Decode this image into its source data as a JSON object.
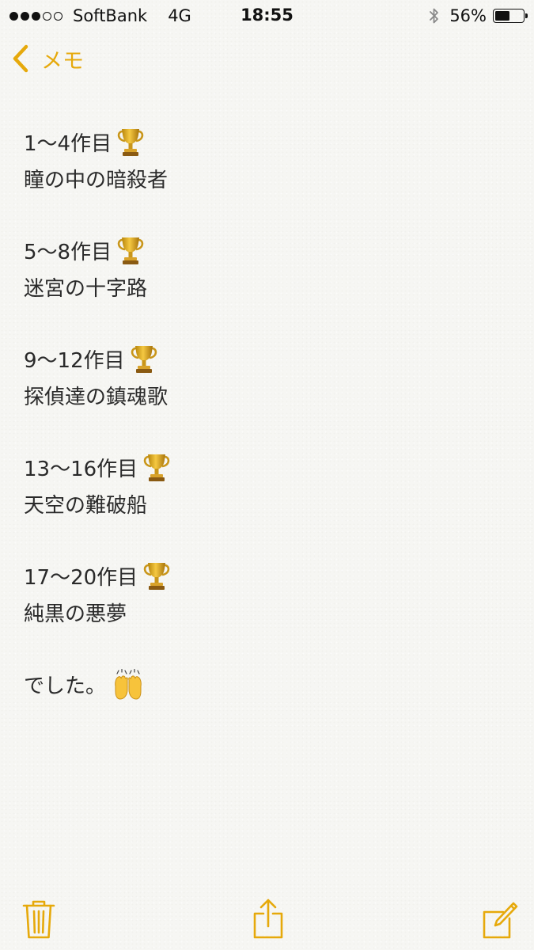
{
  "status_bar": {
    "signal_filled": 3,
    "signal_empty": 2,
    "carrier": "SoftBank",
    "network": "4G",
    "time": "18:55",
    "bluetooth_icon": "bluetooth-icon",
    "battery_percent_text": "56%",
    "battery_level": 0.56
  },
  "nav": {
    "back_label": "メモ",
    "back_icon": "chevron-left-icon"
  },
  "note": {
    "lines": [
      {
        "text": "1〜4作目",
        "emoji": "trophy"
      },
      {
        "text": "瞳の中の暗殺者"
      },
      {
        "blank": true
      },
      {
        "text": "5〜8作目",
        "emoji": "trophy"
      },
      {
        "text": "迷宮の十字路"
      },
      {
        "blank": true
      },
      {
        "text": "9〜12作目",
        "emoji": "trophy"
      },
      {
        "text": "探偵達の鎮魂歌"
      },
      {
        "blank": true
      },
      {
        "text": "13〜16作目",
        "emoji": "trophy"
      },
      {
        "text": "天空の難破船"
      },
      {
        "blank": true
      },
      {
        "text": "17〜20作目",
        "emoji": "trophy"
      },
      {
        "text": "純黒の悪夢"
      },
      {
        "blank": true
      },
      {
        "text": "でした。",
        "emoji": "raised-hands"
      }
    ]
  },
  "toolbar": {
    "trash_icon": "trash-icon",
    "share_icon": "share-icon",
    "compose_icon": "compose-icon"
  },
  "colors": {
    "accent": "#e6a90b",
    "text": "#2a2a2a",
    "background": "#f6f6f3"
  }
}
